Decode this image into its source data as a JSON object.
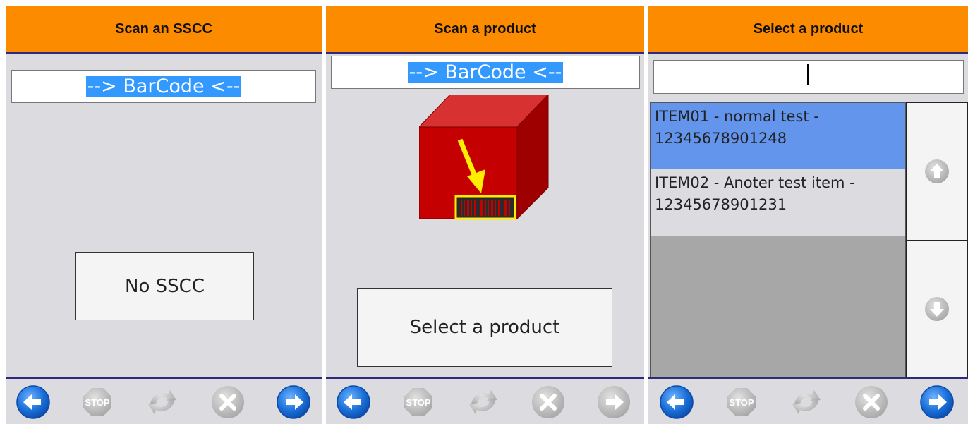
{
  "panels": [
    {
      "title": "Scan an SSCC",
      "barcode_value": "--> BarCode <--",
      "button_label": "No SSCC"
    },
    {
      "title": "Scan a product",
      "barcode_value": "--> BarCode <--",
      "button_label": "Select a product"
    },
    {
      "title": "Select a product",
      "search_value": "",
      "items": [
        {
          "label": "ITEM01 - normal test - 12345678901248",
          "selected": true
        },
        {
          "label": "ITEM02 - Anoter test item - 12345678901231",
          "selected": false
        }
      ]
    }
  ],
  "footer_icons": [
    "back-arrow-icon",
    "stop-icon",
    "refresh-icon",
    "cancel-icon",
    "forward-arrow-icon"
  ],
  "colors": {
    "header": "#fd8b00",
    "divider": "#2d2b7c",
    "background": "#dcdbe0",
    "selection": "#6495ed",
    "nav_blue": "#1a6fd8",
    "disabled_grey": "#b5b5b5"
  }
}
